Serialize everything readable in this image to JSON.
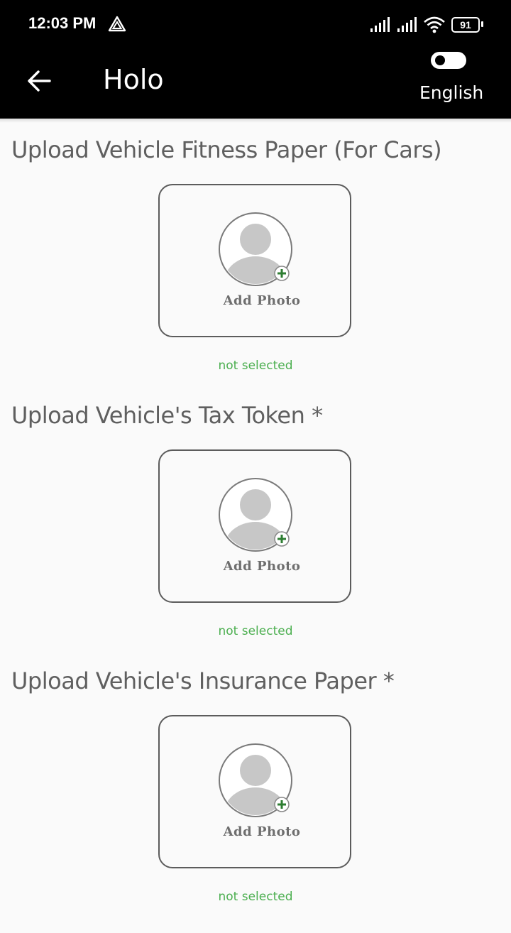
{
  "status_bar": {
    "time": "12:03 PM",
    "battery": "91",
    "icons": [
      "app-notification-icon",
      "signal-icon",
      "signal-icon",
      "wifi-icon",
      "battery-icon"
    ]
  },
  "app_bar": {
    "title": "Holo",
    "language_label": "English",
    "language_toggle_on": false,
    "back_icon": "arrow-left-icon"
  },
  "sections": [
    {
      "title": "Upload Vehicle Fitness Paper (For Cars)",
      "button_label": "Add Photo",
      "status": "not selected"
    },
    {
      "title": "Upload Vehicle's Tax Token *",
      "button_label": "Add Photo",
      "status": "not selected"
    },
    {
      "title": "Upload Vehicle's Insurance Paper *",
      "button_label": "Add Photo",
      "status": "not selected"
    }
  ],
  "colors": {
    "bar_background": "#000000",
    "status_text": "#4caf50",
    "title_text": "#5f5f5f"
  }
}
